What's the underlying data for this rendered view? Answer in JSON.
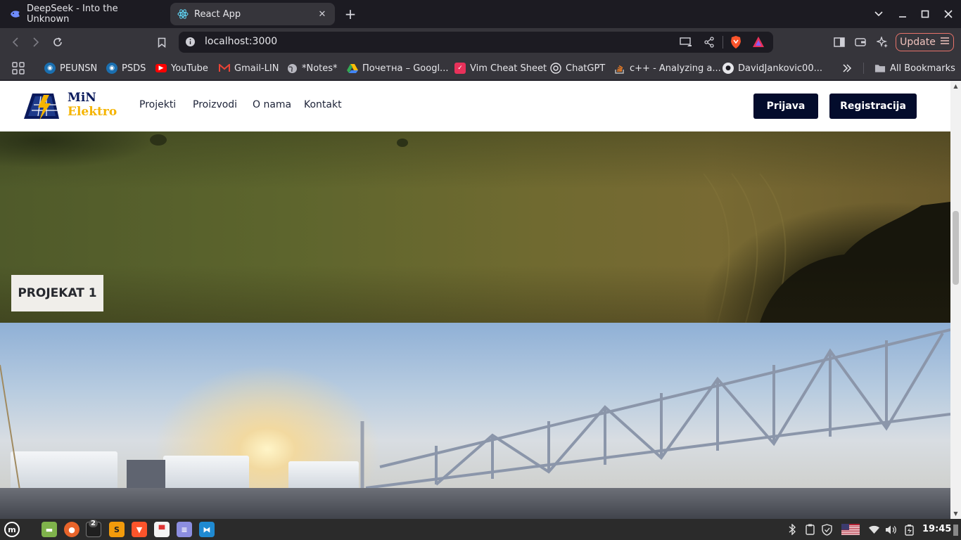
{
  "browser": {
    "tabs": [
      {
        "title": "DeepSeek - Into the Unknown",
        "icon": "deepseek-whale-icon",
        "active": false
      },
      {
        "title": "React App",
        "icon": "react-atom-icon",
        "active": true
      }
    ],
    "url": "localhost:3000",
    "update_label": "Update"
  },
  "bookmarks": [
    {
      "label": "PEUNSN",
      "icon": "globe-site-icon"
    },
    {
      "label": "PSDS",
      "icon": "globe-site-icon"
    },
    {
      "label": "YouTube",
      "icon": "youtube-icon"
    },
    {
      "label": "Gmail-LIN",
      "icon": "gmail-icon"
    },
    {
      "label": "*Notes*",
      "icon": "globe-icon"
    },
    {
      "label": "Почетна – Googl...",
      "icon": "google-drive-icon"
    },
    {
      "label": "Vim Cheat Sheet",
      "icon": "vim-icon"
    },
    {
      "label": "ChatGPT",
      "icon": "chatgpt-icon"
    },
    {
      "label": "c++ - Analyzing a...",
      "icon": "stackoverflow-icon"
    },
    {
      "label": "DavidJankovic00...",
      "icon": "github-icon"
    }
  ],
  "all_bookmarks_label": "All Bookmarks",
  "site": {
    "logo": {
      "line1": "MiN",
      "line2": "Elektro"
    },
    "nav": [
      "Projekti",
      "Proizvodi",
      "O nama",
      "Kontakt"
    ],
    "login_label": "Prijava",
    "register_label": "Registracija",
    "project_label": "PROJEKAT 1",
    "colors": {
      "navy": "#030c2c",
      "yellow": "#f5b400"
    }
  },
  "taskbar": {
    "workspace_badge": "2",
    "time": "19:45"
  }
}
